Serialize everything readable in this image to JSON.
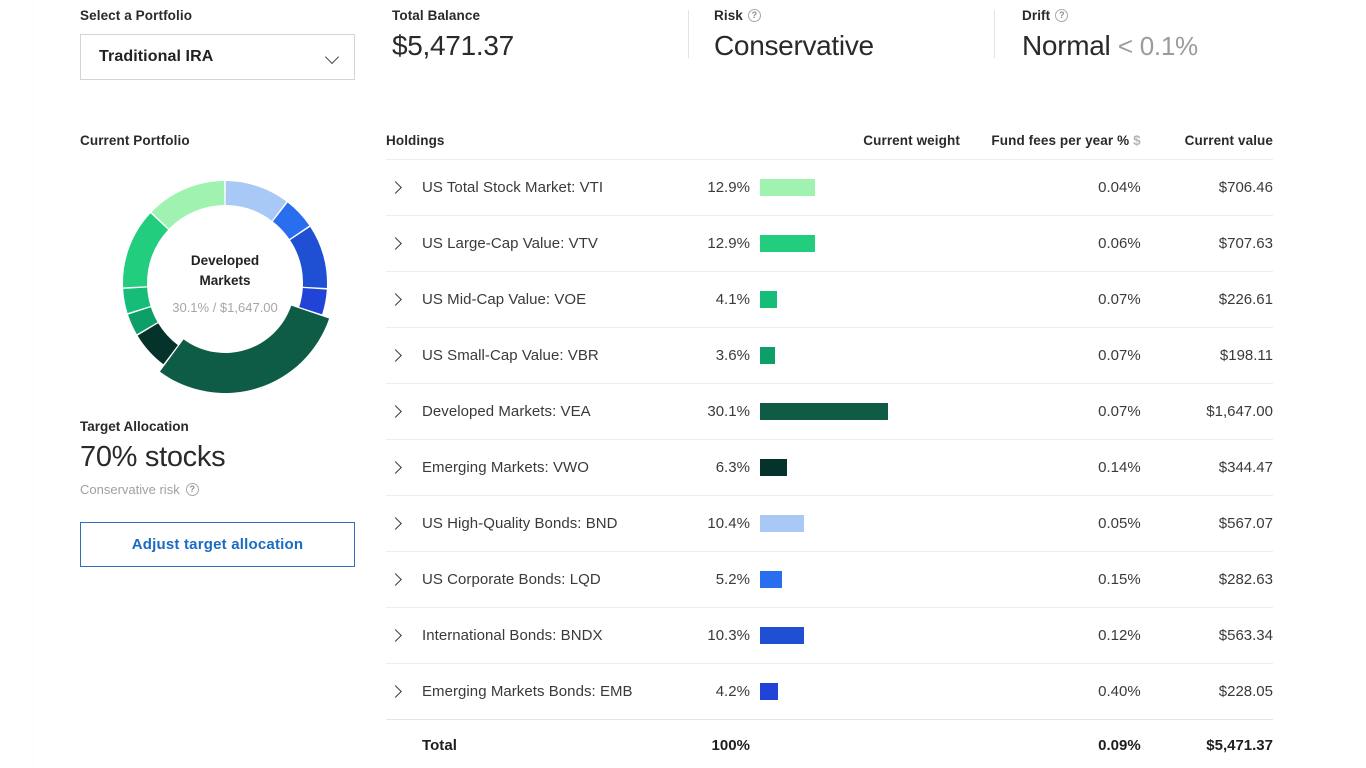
{
  "summary": {
    "portfolio": {
      "label": "Select a Portfolio",
      "selected": "Traditional IRA",
      "chevron_icon": "chevron-down-icon"
    },
    "balance": {
      "label": "Total Balance",
      "value": "$5,471.37"
    },
    "risk": {
      "label": "Risk",
      "value": "Conservative",
      "help_icon": "question-mark-icon"
    },
    "drift": {
      "label": "Drift",
      "value": "Normal",
      "detail": "< 0.1%",
      "help_icon": "question-mark-icon"
    }
  },
  "left": {
    "current_portfolio_label": "Current Portfolio",
    "donut_center_title": "Developed Markets",
    "donut_center_sub": "30.1% / $1,647.00",
    "target_allocation_label": "Target Allocation",
    "target_allocation_value": "70% stocks",
    "risk_note": "Conservative risk",
    "adjust_button": "Adjust target allocation"
  },
  "table": {
    "headers": {
      "holdings": "Holdings",
      "weight": "Current weight",
      "fees": "Fund fees per year %",
      "fees_toggle": "$",
      "value": "Current value"
    },
    "rows": [
      {
        "name": "US Total Stock Market: VTI",
        "weight": "12.9%",
        "weight_num": 12.9,
        "fees": "0.04%",
        "value": "$706.46",
        "color": "#9ff2b0",
        "expand_icon": "chevron-right-icon"
      },
      {
        "name": "US Large-Cap Value: VTV",
        "weight": "12.9%",
        "weight_num": 12.9,
        "fees": "0.06%",
        "value": "$707.63",
        "color": "#23cd7e",
        "expand_icon": "chevron-right-icon"
      },
      {
        "name": "US Mid-Cap Value: VOE",
        "weight": "4.1%",
        "weight_num": 4.1,
        "fees": "0.07%",
        "value": "$226.61",
        "color": "#16bd78",
        "expand_icon": "chevron-right-icon"
      },
      {
        "name": "US Small-Cap Value: VBR",
        "weight": "3.6%",
        "weight_num": 3.6,
        "fees": "0.07%",
        "value": "$198.11",
        "color": "#0e9e67",
        "expand_icon": "chevron-right-icon"
      },
      {
        "name": "Developed Markets: VEA",
        "weight": "30.1%",
        "weight_num": 30.1,
        "fees": "0.07%",
        "value": "$1,647.00",
        "color": "#0e5c46",
        "expand_icon": "chevron-right-icon"
      },
      {
        "name": "Emerging Markets: VWO",
        "weight": "6.3%",
        "weight_num": 6.3,
        "fees": "0.14%",
        "value": "$344.47",
        "color": "#05322a",
        "expand_icon": "chevron-right-icon"
      },
      {
        "name": "US High-Quality Bonds: BND",
        "weight": "10.4%",
        "weight_num": 10.4,
        "fees": "0.05%",
        "value": "$567.07",
        "color": "#a8c8f5",
        "expand_icon": "chevron-right-icon"
      },
      {
        "name": "US Corporate Bonds: LQD",
        "weight": "5.2%",
        "weight_num": 5.2,
        "fees": "0.15%",
        "value": "$282.63",
        "color": "#2a6ef0",
        "expand_icon": "chevron-right-icon"
      },
      {
        "name": "International Bonds: BNDX",
        "weight": "10.3%",
        "weight_num": 10.3,
        "fees": "0.12%",
        "value": "$563.34",
        "color": "#1f50d4",
        "expand_icon": "chevron-right-icon"
      },
      {
        "name": "Emerging Markets Bonds: EMB",
        "weight": "4.2%",
        "weight_num": 4.2,
        "fees": "0.40%",
        "value": "$228.05",
        "color": "#2243d8",
        "expand_icon": "chevron-right-icon"
      }
    ],
    "total": {
      "name": "Total",
      "weight": "100%",
      "fees": "0.09%",
      "value": "$5,471.37"
    }
  },
  "chart_data": {
    "type": "pie",
    "title": "Current Portfolio",
    "center_label": "Developed Markets",
    "center_value": "30.1% / $1,647.00",
    "highlighted_slice": "Developed Markets: VEA",
    "labels": [
      "US High-Quality Bonds: BND",
      "US Corporate Bonds: LQD",
      "International Bonds: BNDX",
      "Emerging Markets Bonds: EMB",
      "Developed Markets: VEA",
      "Emerging Markets: VWO",
      "US Small-Cap Value: VBR",
      "US Mid-Cap Value: VOE",
      "US Large-Cap Value: VTV",
      "US Total Stock Market: VTI"
    ],
    "values": [
      10.4,
      5.2,
      10.3,
      4.2,
      30.1,
      6.3,
      3.6,
      4.1,
      12.9,
      12.9
    ],
    "colors": [
      "#a8c8f5",
      "#2a6ef0",
      "#1f50d4",
      "#2243d8",
      "#0e5c46",
      "#05322a",
      "#0e9e67",
      "#16bd78",
      "#23cd7e",
      "#9ff2b0"
    ],
    "unit": "%",
    "legend": "none",
    "start_angle_deg": 0,
    "direction": "clockwise"
  }
}
